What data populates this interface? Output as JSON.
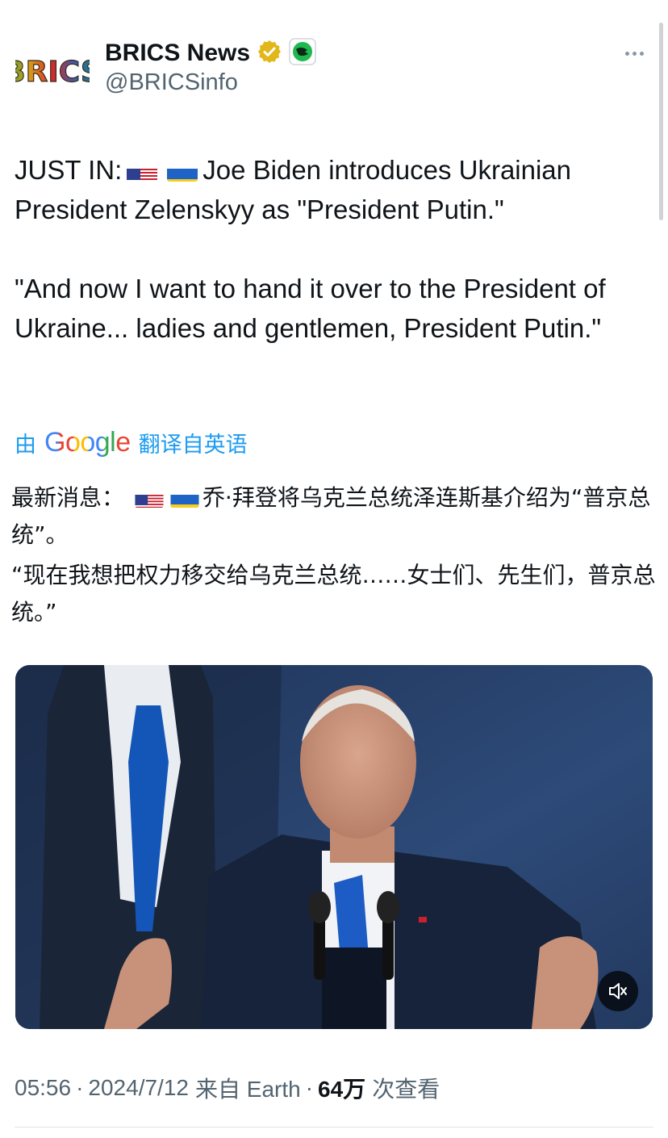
{
  "account": {
    "display_name": "BRICS News",
    "handle": "@BRICSinfo",
    "avatar_text": "BRICS",
    "verified_icon": "gold-check-badge",
    "affiliate_icon": "green-emblem-badge"
  },
  "tweet": {
    "paragraph1_prefix": "JUST IN:",
    "paragraph1_flags": [
      "us-flag",
      "ukraine-flag"
    ],
    "paragraph1_text": "Joe Biden introduces Ukrainian President Zelenskyy as \"President Putin.\"",
    "paragraph2": "\"And now I want to hand it over to the President of Ukraine... ladies and gentlemen, President Putin.\""
  },
  "translation": {
    "prefix": "由",
    "brand": "Google",
    "suffix": "翻译自英语",
    "paragraph1_prefix": "最新消息：",
    "paragraph1_text": "乔·拜登将乌克兰总统泽连斯基介绍为“普京总统”。",
    "paragraph2": "“现在我想把权力移交给乌克兰总统……女士们、先生们，普京总统。”"
  },
  "media": {
    "type": "video",
    "mute_icon": "speaker-muted-icon"
  },
  "meta": {
    "time": "05:56",
    "date": "2024/7/12",
    "source": "来自 Earth",
    "views_count": "64万",
    "views_label": "次查看"
  },
  "colors": {
    "link_blue": "#1d9bf0",
    "text_primary": "#0f1419",
    "text_secondary": "#536471",
    "verified_gold": "#e2b719"
  }
}
